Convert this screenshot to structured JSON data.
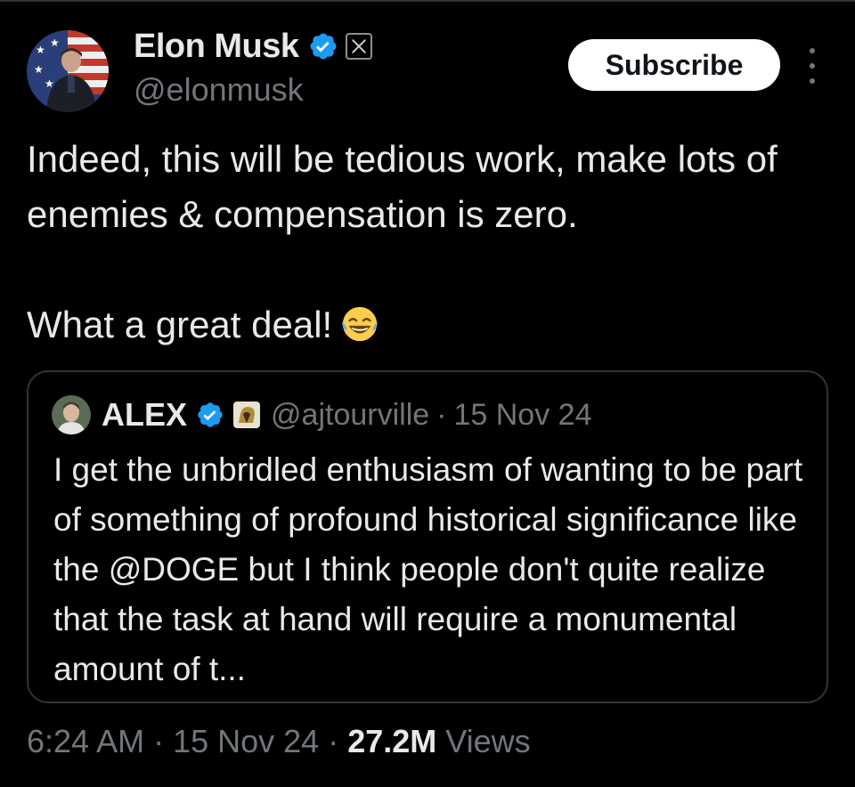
{
  "author": {
    "name": "Elon Musk",
    "handle": "@elonmusk",
    "verified": true,
    "badge_icon": "x-logo-icon"
  },
  "actions": {
    "subscribe_label": "Subscribe",
    "more_icon": "more-vertical-icon"
  },
  "tweet": {
    "paragraphs": [
      "Indeed, this will be tedious work, make lots of enemies & compensation is zero.",
      "What a great deal!"
    ],
    "emoji": "face-with-tears-of-joy"
  },
  "quote": {
    "name": "ALEX",
    "verified": true,
    "badge_icon": "lion-emblem-icon",
    "handle": "@ajtourville",
    "separator": "·",
    "date": "15 Nov 24",
    "text": "I get the unbridled enthusiasm of wanting to be part of something of profound historical significance like the @DOGE but I think people don't quite realize that the task at hand will require a monumental amount of t..."
  },
  "meta": {
    "time": "6:24 AM",
    "separator": "·",
    "date": "15 Nov 24",
    "views_count": "27.2M",
    "views_label": "Views"
  },
  "colors": {
    "background": "#000000",
    "text": "#e7e9ea",
    "secondary": "#71767b",
    "verified_blue": "#1d9bf0",
    "border": "#2f3336"
  }
}
